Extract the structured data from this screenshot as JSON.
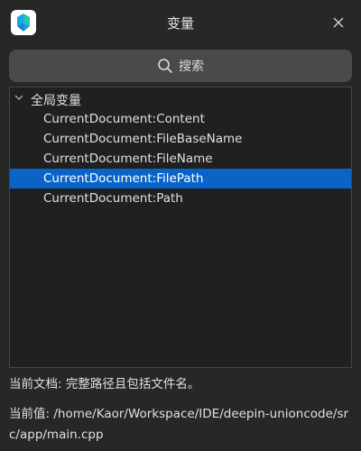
{
  "window": {
    "title": "变量"
  },
  "search": {
    "label": "搜索"
  },
  "tree": {
    "root_label": "全局变量",
    "items": [
      {
        "label": "CurrentDocument:Content",
        "selected": false
      },
      {
        "label": "CurrentDocument:FileBaseName",
        "selected": false
      },
      {
        "label": "CurrentDocument:FileName",
        "selected": false
      },
      {
        "label": "CurrentDocument:FilePath",
        "selected": true
      },
      {
        "label": "CurrentDocument:Path",
        "selected": false
      }
    ]
  },
  "details": {
    "description": "当前文档: 完整路径且包括文件名。",
    "value": "当前值:  /home/Kaor/Workspace/IDE/deepin-unioncode/src/app/main.cpp"
  },
  "colors": {
    "background": "#272727",
    "selection": "#0a64c8",
    "search_bg": "#4a4a4a"
  },
  "icons": {
    "logo": "app-logo",
    "close": "close-icon",
    "search": "search-icon",
    "expand": "chevron-down-icon"
  }
}
